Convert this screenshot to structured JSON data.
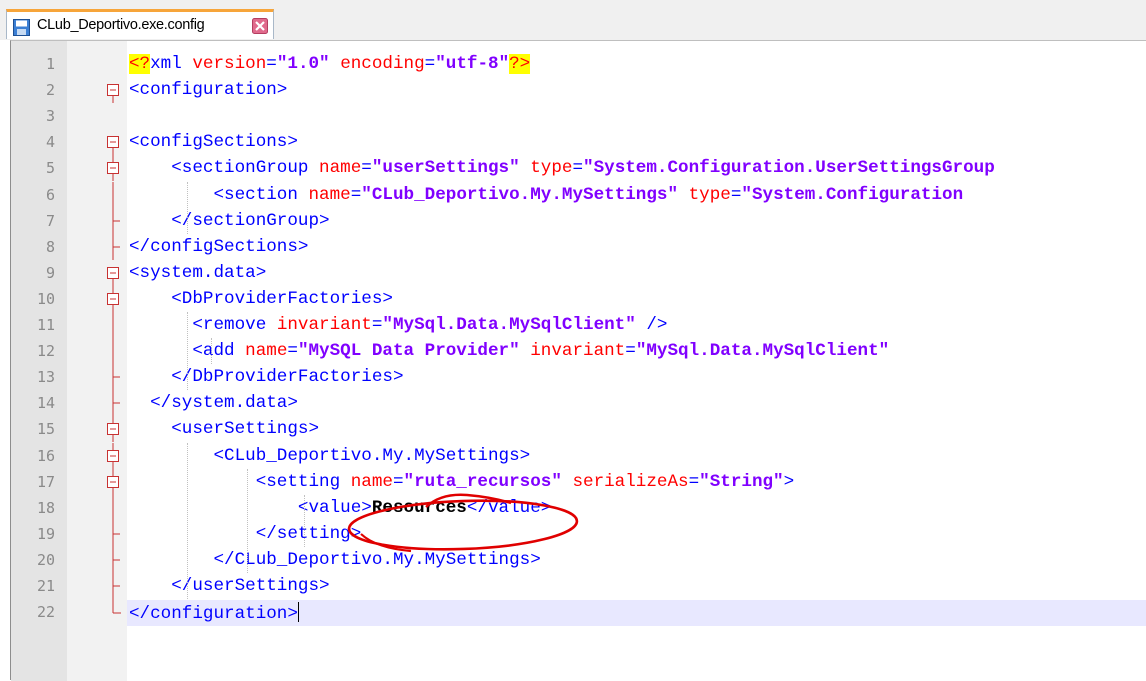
{
  "tab": {
    "title": "CLub_Deportivo.exe.config",
    "save_icon": "floppy-save-icon",
    "close_icon": "close-tab-icon"
  },
  "lines": [
    {
      "n": "1",
      "segs": [
        [
          "pi",
          "<?"
        ],
        [
          "tag",
          "xml "
        ],
        [
          "attr",
          "version"
        ],
        [
          "tag",
          "="
        ],
        [
          "val",
          "\"1.0\""
        ],
        [
          "tag",
          " "
        ],
        [
          "attr",
          "encoding"
        ],
        [
          "tag",
          "="
        ],
        [
          "val",
          "\"utf-8\""
        ],
        [
          "pi",
          "?>"
        ]
      ]
    },
    {
      "n": "2",
      "segs": [
        [
          "tag",
          "<configuration>"
        ]
      ]
    },
    {
      "n": "3",
      "segs": []
    },
    {
      "n": "4",
      "segs": [
        [
          "tag",
          "<configSections>"
        ]
      ]
    },
    {
      "n": "5",
      "segs": [
        [
          "tag",
          "    <sectionGroup "
        ],
        [
          "attr",
          "name"
        ],
        [
          "tag",
          "="
        ],
        [
          "val",
          "\"userSettings\""
        ],
        [
          "tag",
          " "
        ],
        [
          "attr",
          "type"
        ],
        [
          "tag",
          "="
        ],
        [
          "val",
          "\"System.Configuration.UserSettingsGroup"
        ]
      ]
    },
    {
      "n": "6",
      "segs": [
        [
          "tag",
          "        <section "
        ],
        [
          "attr",
          "name"
        ],
        [
          "tag",
          "="
        ],
        [
          "val",
          "\"CLub_Deportivo.My.MySettings\""
        ],
        [
          "tag",
          " "
        ],
        [
          "attr",
          "type"
        ],
        [
          "tag",
          "="
        ],
        [
          "val",
          "\"System.Configuration"
        ]
      ]
    },
    {
      "n": "7",
      "segs": [
        [
          "tag",
          "    </sectionGroup>"
        ]
      ]
    },
    {
      "n": "8",
      "segs": [
        [
          "tag",
          "</configSections>"
        ]
      ]
    },
    {
      "n": "9",
      "segs": [
        [
          "tag",
          "<system.data>"
        ]
      ]
    },
    {
      "n": "10",
      "segs": [
        [
          "tag",
          "    <DbProviderFactories>"
        ]
      ]
    },
    {
      "n": "11",
      "segs": [
        [
          "tag",
          "      <remove "
        ],
        [
          "attr",
          "invariant"
        ],
        [
          "tag",
          "="
        ],
        [
          "val",
          "\"MySql.Data.MySqlClient\""
        ],
        [
          "tag",
          " />"
        ]
      ]
    },
    {
      "n": "12",
      "segs": [
        [
          "tag",
          "      <add "
        ],
        [
          "attr",
          "name"
        ],
        [
          "tag",
          "="
        ],
        [
          "val",
          "\"MySQL Data Provider\""
        ],
        [
          "tag",
          " "
        ],
        [
          "attr",
          "invariant"
        ],
        [
          "tag",
          "="
        ],
        [
          "val",
          "\"MySql.Data.MySqlClient\""
        ],
        [
          "tag",
          " "
        ]
      ]
    },
    {
      "n": "13",
      "segs": [
        [
          "tag",
          "    </DbProviderFactories>"
        ]
      ]
    },
    {
      "n": "14",
      "segs": [
        [
          "tag",
          "  </system.data>"
        ]
      ]
    },
    {
      "n": "15",
      "segs": [
        [
          "tag",
          "    <userSettings>"
        ]
      ]
    },
    {
      "n": "16",
      "segs": [
        [
          "tag",
          "        <CLub_Deportivo.My.MySettings>"
        ]
      ]
    },
    {
      "n": "17",
      "segs": [
        [
          "tag",
          "            <setting "
        ],
        [
          "attr",
          "name"
        ],
        [
          "tag",
          "="
        ],
        [
          "val",
          "\"ruta_recursos\""
        ],
        [
          "tag",
          " "
        ],
        [
          "attr",
          "serializeAs"
        ],
        [
          "tag",
          "="
        ],
        [
          "val",
          "\"String\""
        ],
        [
          "tag",
          ">"
        ]
      ]
    },
    {
      "n": "18",
      "segs": [
        [
          "tag",
          "                <value>"
        ],
        [
          "text",
          "Resources"
        ],
        [
          "tag",
          "</value>"
        ]
      ]
    },
    {
      "n": "19",
      "segs": [
        [
          "tag",
          "            </setting>"
        ]
      ]
    },
    {
      "n": "20",
      "segs": [
        [
          "tag",
          "        </CLub_Deportivo.My.MySettings>"
        ]
      ]
    },
    {
      "n": "21",
      "segs": [
        [
          "tag",
          "    </userSettings>"
        ]
      ]
    },
    {
      "n": "22",
      "segs": [
        [
          "tag",
          "</configuration>"
        ]
      ]
    }
  ],
  "current_line": 22,
  "colors": {
    "tag": "#0000ff",
    "attr": "#ff0000",
    "val": "#8000ff",
    "pi_bg": "#ffff00",
    "annotation": "#e00000"
  }
}
